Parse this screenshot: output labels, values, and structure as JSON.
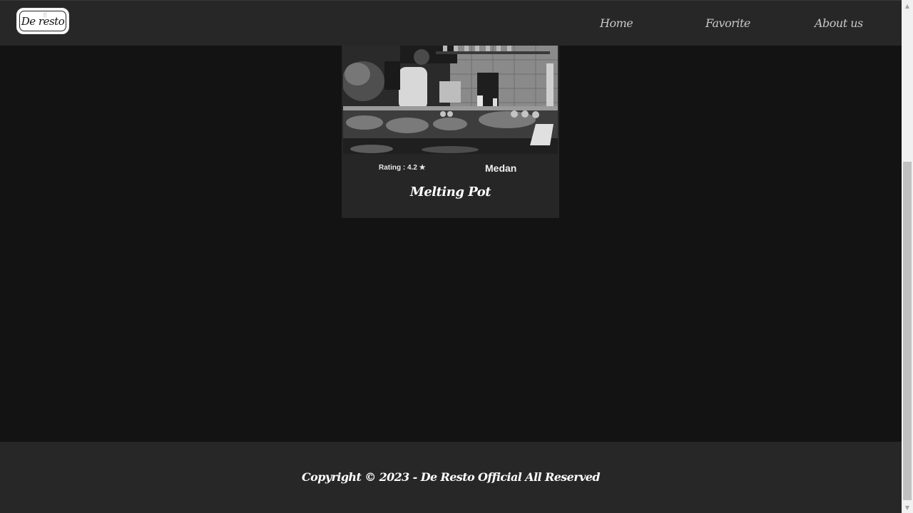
{
  "header": {
    "logo": {
      "text": "De resto",
      "mark": "🍴"
    },
    "nav": [
      {
        "label": "Home"
      },
      {
        "label": "Favorite"
      },
      {
        "label": "About us"
      }
    ]
  },
  "restaurant_card": {
    "image": {
      "description_icon": "restaurant-kitchen-photo"
    },
    "rating": "Rating : 4.2 ★",
    "city": "Medan",
    "name": "Melting Pot"
  },
  "footer": {
    "copyright": "Copyright © 2023 - De Resto Official All Reserved"
  },
  "colors": {
    "background": "#131313",
    "header_bg": "#272727",
    "card_bg": "#262626",
    "nav_text": "#c8c8c8",
    "text": "#ffffff"
  }
}
